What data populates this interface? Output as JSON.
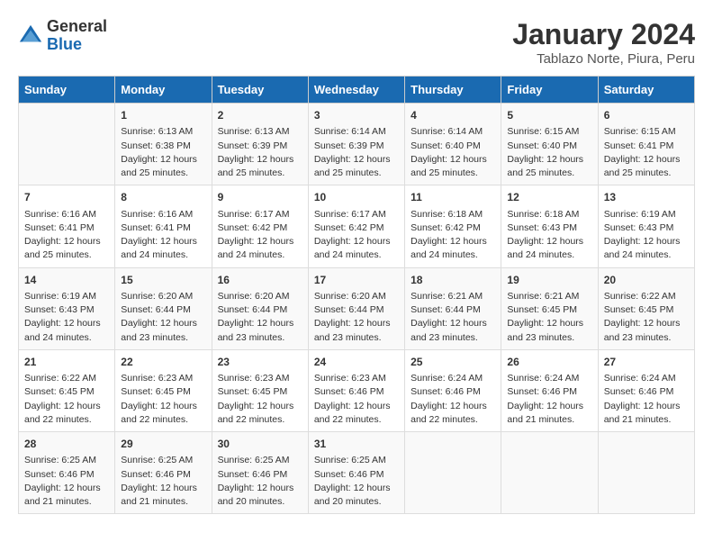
{
  "logo": {
    "general": "General",
    "blue": "Blue"
  },
  "title": "January 2024",
  "subtitle": "Tablazo Norte, Piura, Peru",
  "weekdays": [
    "Sunday",
    "Monday",
    "Tuesday",
    "Wednesday",
    "Thursday",
    "Friday",
    "Saturday"
  ],
  "weeks": [
    [
      {
        "day": "",
        "sunrise": "",
        "sunset": "",
        "daylight": ""
      },
      {
        "day": "1",
        "sunrise": "Sunrise: 6:13 AM",
        "sunset": "Sunset: 6:38 PM",
        "daylight": "Daylight: 12 hours and 25 minutes."
      },
      {
        "day": "2",
        "sunrise": "Sunrise: 6:13 AM",
        "sunset": "Sunset: 6:39 PM",
        "daylight": "Daylight: 12 hours and 25 minutes."
      },
      {
        "day": "3",
        "sunrise": "Sunrise: 6:14 AM",
        "sunset": "Sunset: 6:39 PM",
        "daylight": "Daylight: 12 hours and 25 minutes."
      },
      {
        "day": "4",
        "sunrise": "Sunrise: 6:14 AM",
        "sunset": "Sunset: 6:40 PM",
        "daylight": "Daylight: 12 hours and 25 minutes."
      },
      {
        "day": "5",
        "sunrise": "Sunrise: 6:15 AM",
        "sunset": "Sunset: 6:40 PM",
        "daylight": "Daylight: 12 hours and 25 minutes."
      },
      {
        "day": "6",
        "sunrise": "Sunrise: 6:15 AM",
        "sunset": "Sunset: 6:41 PM",
        "daylight": "Daylight: 12 hours and 25 minutes."
      }
    ],
    [
      {
        "day": "7",
        "sunrise": "Sunrise: 6:16 AM",
        "sunset": "Sunset: 6:41 PM",
        "daylight": "Daylight: 12 hours and 25 minutes."
      },
      {
        "day": "8",
        "sunrise": "Sunrise: 6:16 AM",
        "sunset": "Sunset: 6:41 PM",
        "daylight": "Daylight: 12 hours and 24 minutes."
      },
      {
        "day": "9",
        "sunrise": "Sunrise: 6:17 AM",
        "sunset": "Sunset: 6:42 PM",
        "daylight": "Daylight: 12 hours and 24 minutes."
      },
      {
        "day": "10",
        "sunrise": "Sunrise: 6:17 AM",
        "sunset": "Sunset: 6:42 PM",
        "daylight": "Daylight: 12 hours and 24 minutes."
      },
      {
        "day": "11",
        "sunrise": "Sunrise: 6:18 AM",
        "sunset": "Sunset: 6:42 PM",
        "daylight": "Daylight: 12 hours and 24 minutes."
      },
      {
        "day": "12",
        "sunrise": "Sunrise: 6:18 AM",
        "sunset": "Sunset: 6:43 PM",
        "daylight": "Daylight: 12 hours and 24 minutes."
      },
      {
        "day": "13",
        "sunrise": "Sunrise: 6:19 AM",
        "sunset": "Sunset: 6:43 PM",
        "daylight": "Daylight: 12 hours and 24 minutes."
      }
    ],
    [
      {
        "day": "14",
        "sunrise": "Sunrise: 6:19 AM",
        "sunset": "Sunset: 6:43 PM",
        "daylight": "Daylight: 12 hours and 24 minutes."
      },
      {
        "day": "15",
        "sunrise": "Sunrise: 6:20 AM",
        "sunset": "Sunset: 6:44 PM",
        "daylight": "Daylight: 12 hours and 23 minutes."
      },
      {
        "day": "16",
        "sunrise": "Sunrise: 6:20 AM",
        "sunset": "Sunset: 6:44 PM",
        "daylight": "Daylight: 12 hours and 23 minutes."
      },
      {
        "day": "17",
        "sunrise": "Sunrise: 6:20 AM",
        "sunset": "Sunset: 6:44 PM",
        "daylight": "Daylight: 12 hours and 23 minutes."
      },
      {
        "day": "18",
        "sunrise": "Sunrise: 6:21 AM",
        "sunset": "Sunset: 6:44 PM",
        "daylight": "Daylight: 12 hours and 23 minutes."
      },
      {
        "day": "19",
        "sunrise": "Sunrise: 6:21 AM",
        "sunset": "Sunset: 6:45 PM",
        "daylight": "Daylight: 12 hours and 23 minutes."
      },
      {
        "day": "20",
        "sunrise": "Sunrise: 6:22 AM",
        "sunset": "Sunset: 6:45 PM",
        "daylight": "Daylight: 12 hours and 23 minutes."
      }
    ],
    [
      {
        "day": "21",
        "sunrise": "Sunrise: 6:22 AM",
        "sunset": "Sunset: 6:45 PM",
        "daylight": "Daylight: 12 hours and 22 minutes."
      },
      {
        "day": "22",
        "sunrise": "Sunrise: 6:23 AM",
        "sunset": "Sunset: 6:45 PM",
        "daylight": "Daylight: 12 hours and 22 minutes."
      },
      {
        "day": "23",
        "sunrise": "Sunrise: 6:23 AM",
        "sunset": "Sunset: 6:45 PM",
        "daylight": "Daylight: 12 hours and 22 minutes."
      },
      {
        "day": "24",
        "sunrise": "Sunrise: 6:23 AM",
        "sunset": "Sunset: 6:46 PM",
        "daylight": "Daylight: 12 hours and 22 minutes."
      },
      {
        "day": "25",
        "sunrise": "Sunrise: 6:24 AM",
        "sunset": "Sunset: 6:46 PM",
        "daylight": "Daylight: 12 hours and 22 minutes."
      },
      {
        "day": "26",
        "sunrise": "Sunrise: 6:24 AM",
        "sunset": "Sunset: 6:46 PM",
        "daylight": "Daylight: 12 hours and 21 minutes."
      },
      {
        "day": "27",
        "sunrise": "Sunrise: 6:24 AM",
        "sunset": "Sunset: 6:46 PM",
        "daylight": "Daylight: 12 hours and 21 minutes."
      }
    ],
    [
      {
        "day": "28",
        "sunrise": "Sunrise: 6:25 AM",
        "sunset": "Sunset: 6:46 PM",
        "daylight": "Daylight: 12 hours and 21 minutes."
      },
      {
        "day": "29",
        "sunrise": "Sunrise: 6:25 AM",
        "sunset": "Sunset: 6:46 PM",
        "daylight": "Daylight: 12 hours and 21 minutes."
      },
      {
        "day": "30",
        "sunrise": "Sunrise: 6:25 AM",
        "sunset": "Sunset: 6:46 PM",
        "daylight": "Daylight: 12 hours and 20 minutes."
      },
      {
        "day": "31",
        "sunrise": "Sunrise: 6:25 AM",
        "sunset": "Sunset: 6:46 PM",
        "daylight": "Daylight: 12 hours and 20 minutes."
      },
      {
        "day": "",
        "sunrise": "",
        "sunset": "",
        "daylight": ""
      },
      {
        "day": "",
        "sunrise": "",
        "sunset": "",
        "daylight": ""
      },
      {
        "day": "",
        "sunrise": "",
        "sunset": "",
        "daylight": ""
      }
    ]
  ]
}
